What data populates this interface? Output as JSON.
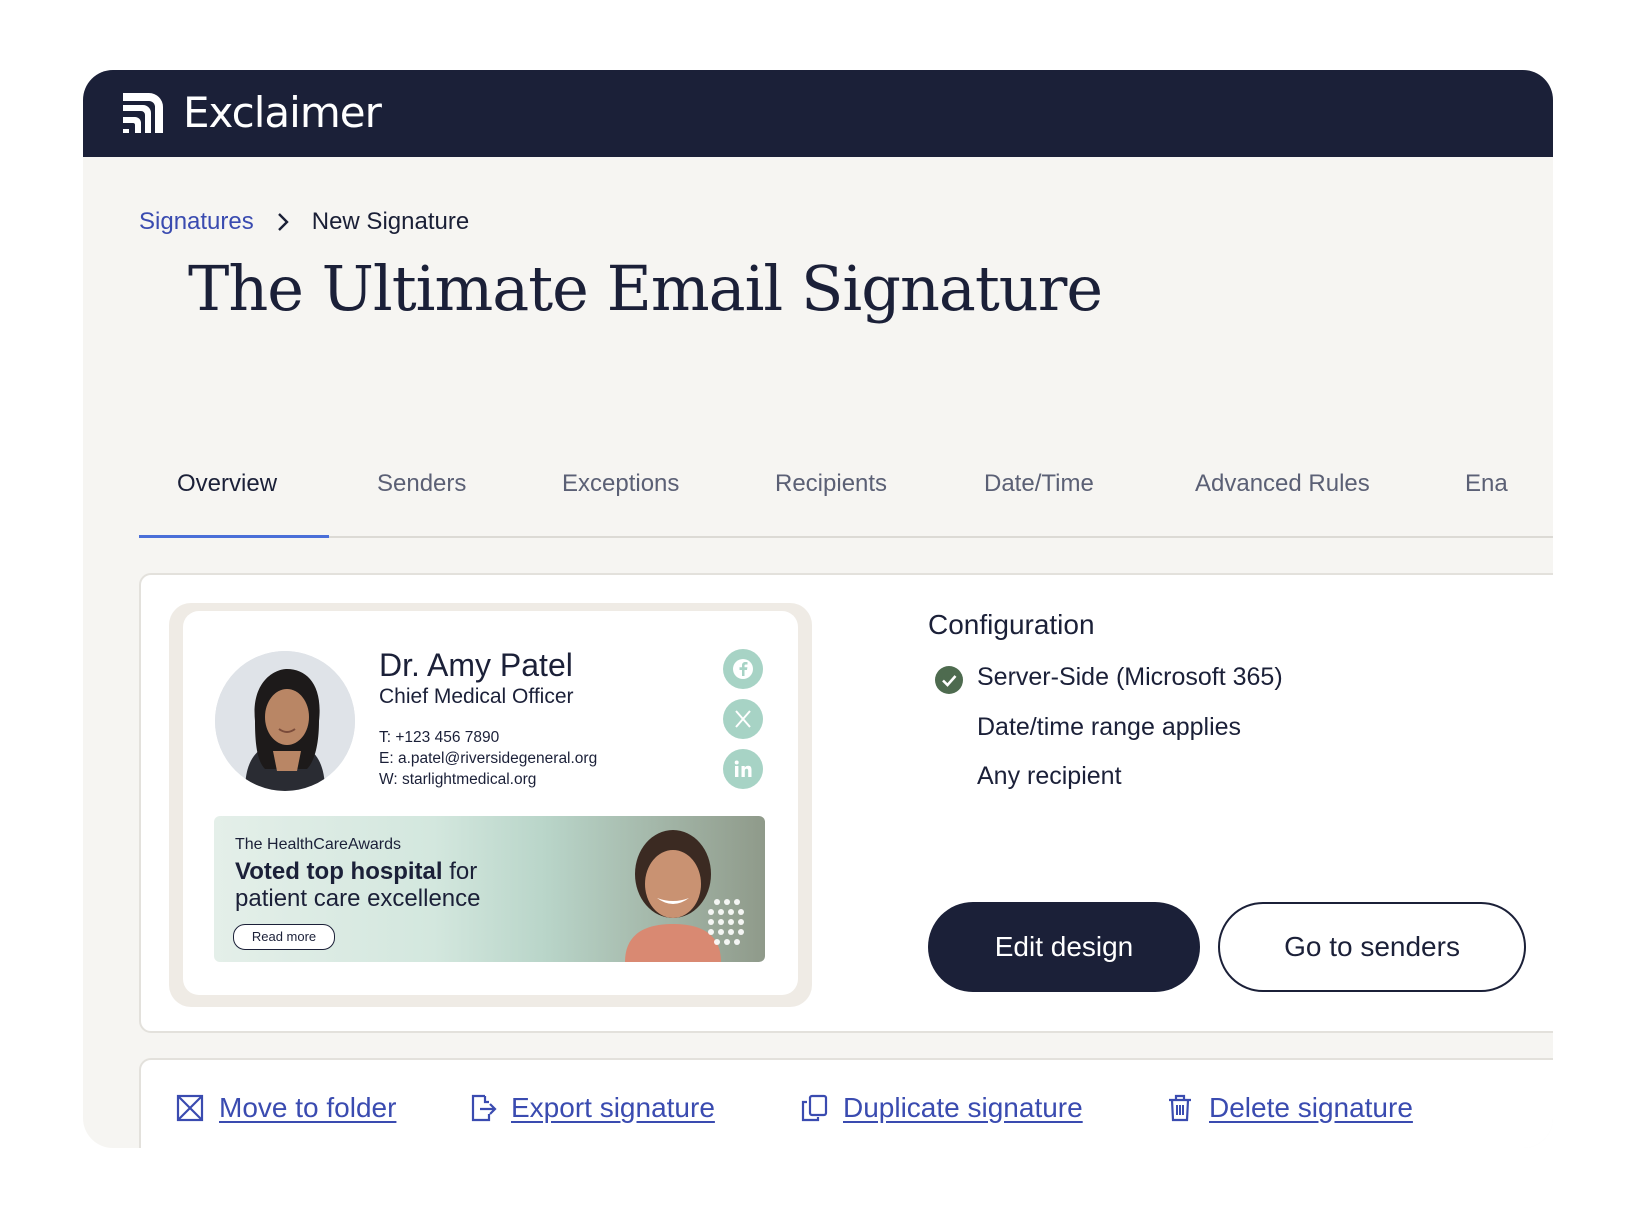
{
  "app": {
    "brand": "Exclaimer"
  },
  "breadcrumb": {
    "parent": "Signatures",
    "current": "New Signature"
  },
  "page": {
    "title": "The Ultimate Email Signature"
  },
  "tabs": [
    {
      "label": "Overview",
      "active": true
    },
    {
      "label": "Senders"
    },
    {
      "label": "Exceptions"
    },
    {
      "label": "Recipients"
    },
    {
      "label": "Date/Time"
    },
    {
      "label": "Advanced Rules"
    },
    {
      "label": "Ena"
    }
  ],
  "signature": {
    "name": "Dr. Amy Patel",
    "role": "Chief Medical Officer",
    "phone": "T: +123 456 7890",
    "email": "E: a.patel@riversidegeneral.org",
    "web": "W: starlightmedical.org",
    "social_icons": [
      "facebook-icon",
      "x-icon",
      "linkedin-icon"
    ],
    "banner": {
      "small": "The HealthCareAwards",
      "bold": "Voted top hospital",
      "rest1": " for",
      "line2": "patient care excellence",
      "cta": "Read more"
    }
  },
  "config": {
    "title": "Configuration",
    "items": [
      {
        "label": "Server-Side (Microsoft 365)",
        "checked": true
      },
      {
        "label": "Date/time range applies"
      },
      {
        "label": "Any recipient"
      }
    ]
  },
  "buttons": {
    "edit": "Edit design",
    "senders": "Go to senders"
  },
  "actions": [
    {
      "label": "Move to folder",
      "icon": "move-icon"
    },
    {
      "label": "Export signature",
      "icon": "export-icon"
    },
    {
      "label": "Duplicate signature",
      "icon": "duplicate-icon"
    },
    {
      "label": "Delete signature",
      "icon": "trash-icon"
    }
  ],
  "colors": {
    "navy": "#1b2038",
    "link": "#3a4bb0",
    "accent": "#4a6fd8",
    "social": "#a7d3c5",
    "check": "#4e6b4f"
  }
}
